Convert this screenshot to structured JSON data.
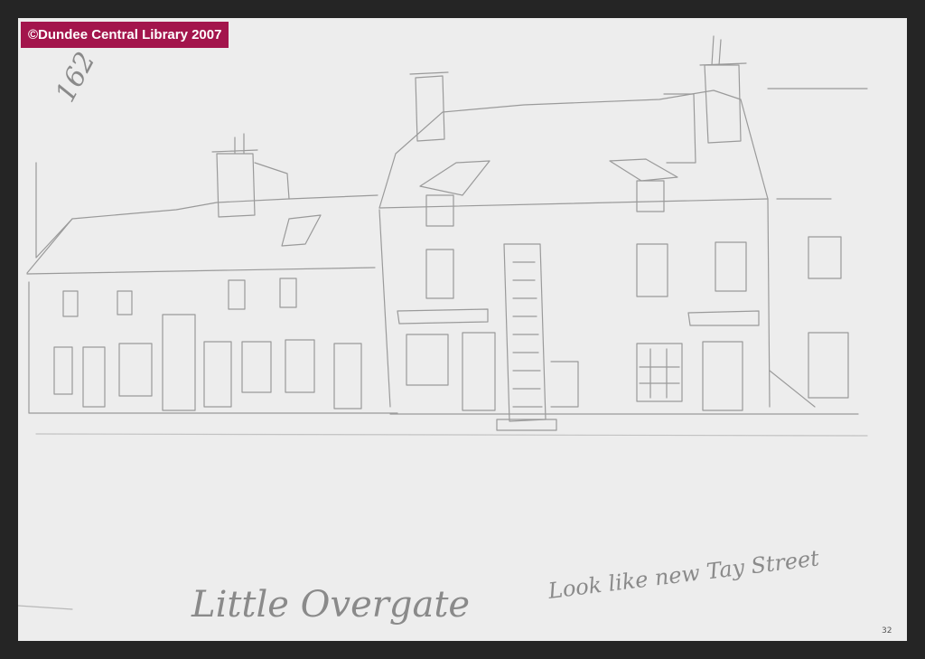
{
  "watermark": {
    "text": "©Dundee Central Library 2007",
    "color": "#a3154c"
  },
  "sketch": {
    "corner_number": "162",
    "caption_left": "Little Overgate",
    "caption_right": "Look like new Tay Street",
    "page_number": "32"
  }
}
